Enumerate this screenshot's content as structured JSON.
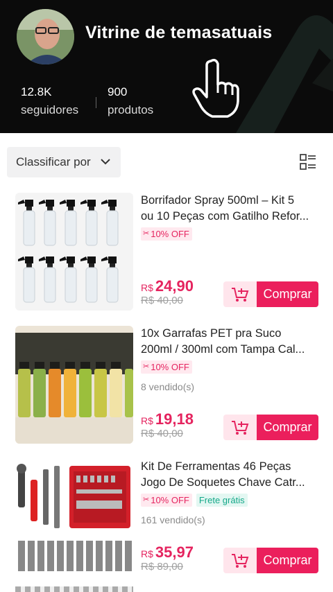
{
  "header": {
    "shop_name": "Vitrine de temasatuais",
    "followers": {
      "value": "12.8K",
      "label": "seguidores"
    },
    "products": {
      "value": "900",
      "label": "produtos"
    }
  },
  "sort": {
    "label": "Classificar por"
  },
  "currency": "R$",
  "buy_label": "Comprar",
  "products": [
    {
      "title_line1": "Borrifador Spray 500ml – Kit 5",
      "title_line2": "ou 10 Peças com Gatilho Refor...",
      "discount": "10% OFF",
      "free_shipping": "",
      "sold": "",
      "price": "24,90",
      "old_price": "R$ 40,00"
    },
    {
      "title_line1": "10x Garrafas PET pra Suco",
      "title_line2": "200ml / 300ml com Tampa Cal...",
      "discount": "10% OFF",
      "free_shipping": "",
      "sold": "8 vendido(s)",
      "price": "19,18",
      "old_price": "R$ 40,00"
    },
    {
      "title_line1": "Kit De Ferramentas 46 Peças",
      "title_line2": "Jogo De Soquetes Chave Catr...",
      "discount": "10% OFF",
      "free_shipping": "Frete grátis",
      "sold": "161 vendido(s)",
      "price": "35,97",
      "old_price": "R$ 89,00"
    }
  ],
  "colors": {
    "accent": "#eb1f5c",
    "header_bg": "#0b0b0b",
    "free_shipping": "#15a889"
  }
}
